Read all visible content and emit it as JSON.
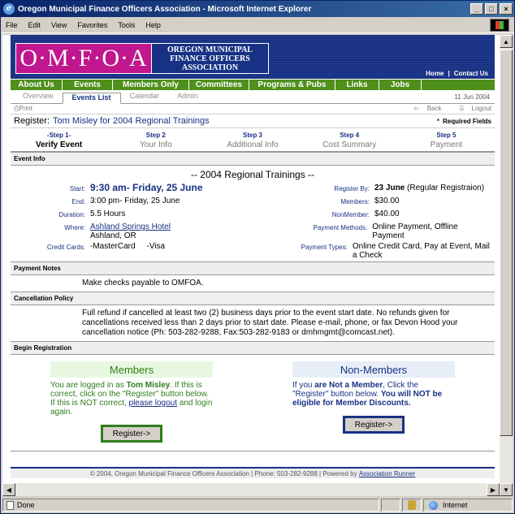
{
  "window": {
    "title": "Oregon Municipal Finance Officers Association - Microsoft Internet Explorer",
    "menu": [
      "File",
      "Edit",
      "View",
      "Favorites",
      "Tools",
      "Help"
    ]
  },
  "header": {
    "logo_letters": "O·M·F·O·A",
    "logo_full": "OREGON MUNICIPAL FINANCE OFFICERS ASSOCIATION",
    "home_link": "Home",
    "contact_link": "Contact Us"
  },
  "nav": [
    "About Us",
    "Events",
    "Members Only",
    "Committees",
    "Programs & Pubs",
    "Links",
    "Jobs"
  ],
  "subtabs": {
    "items": [
      "Overview",
      "Events List",
      "Calendar",
      "Admin"
    ],
    "active_index": 1,
    "date": "11 Jun 2004"
  },
  "tools": {
    "print": "Print",
    "back": "Back",
    "logout": "Logout"
  },
  "register": {
    "label": "Register:",
    "title": "Tom Misley for 2004 Regional Trainings",
    "required": "Required Fields",
    "required_marker": "*"
  },
  "steps": [
    {
      "n": "-Step 1-",
      "label": "Verify Event"
    },
    {
      "n": "Step 2",
      "label": "Your Info"
    },
    {
      "n": "Step 3",
      "label": "Additional Info"
    },
    {
      "n": "Step 4",
      "label": "Cost Summary"
    },
    {
      "n": "Step 5",
      "label": "Payment"
    }
  ],
  "event_info": {
    "section": "Event Info",
    "title": "-- 2004 Regional Trainings --",
    "start_k": "Start:",
    "start_v": "9:30 am- Friday, 25 June",
    "end_k": "End:",
    "end_v": "3:00 pm- Friday, 25 June",
    "duration_k": "Duration:",
    "duration_v": "5.5 Hours",
    "where_k": "Where:",
    "where_v": "Ashland Springs Hotel",
    "where_city": "Ashland, OR",
    "cards_k": "Credit Cards:",
    "cards_v1": "-MasterCard",
    "cards_v2": "-Visa",
    "regby_k": "Register By:",
    "regby_v": "23 June",
    "regby_note": "(Regular Registraion)",
    "members_k": "Members:",
    "members_v": "$30.00",
    "nonmembers_k": "NonMember:",
    "nonmembers_v": "$40.00",
    "paymethods_k": "Payment Methods:",
    "paymethods_v": "Online Payment, Offline Payment",
    "paytypes_k": "Payment Types:",
    "paytypes_v": "Online Credit Card, Pay at Event, Mail a Check"
  },
  "payment_notes": {
    "section": "Payment Notes",
    "text": "Make checks payable to OMFOA."
  },
  "cancellation": {
    "section": "Cancellation Policy",
    "text": "Full refund if cancelled at least two (2) business days prior to the event start date. No refunds given for cancellations received less than 2 days prior to start date. Please e-mail, phone, or fax Devon Hood your cancellation notice (Ph: 503-282-9288, Fax:503-282-9183 or dmhmgmt@comcast.net)."
  },
  "begin": {
    "section": "Begin Registration",
    "members_head": "Members",
    "members_t1": "You are logged in as",
    "members_name": "Tom Misley",
    "members_t2": ". If this is correct, click on the \"Register\" button below. If this is NOT correct,",
    "members_link1": "please logout",
    "members_t3": "and login again.",
    "nonmembers_head": "Non-Members",
    "nonmembers_t1": "If you",
    "nonmembers_not": "are Not a Member",
    "nonmembers_t2": ", Click the \"Register\" button below.",
    "nonmembers_bold": "You will NOT be eligible for Member Discounts.",
    "button": "Register->"
  },
  "footer": {
    "text": "© 2004, Oregon Municipal Finance Officers Association | Phone: 503-282-9288 | Powered by",
    "link": "Association Runner"
  },
  "status": {
    "left": "Done",
    "zone": "Internet"
  }
}
